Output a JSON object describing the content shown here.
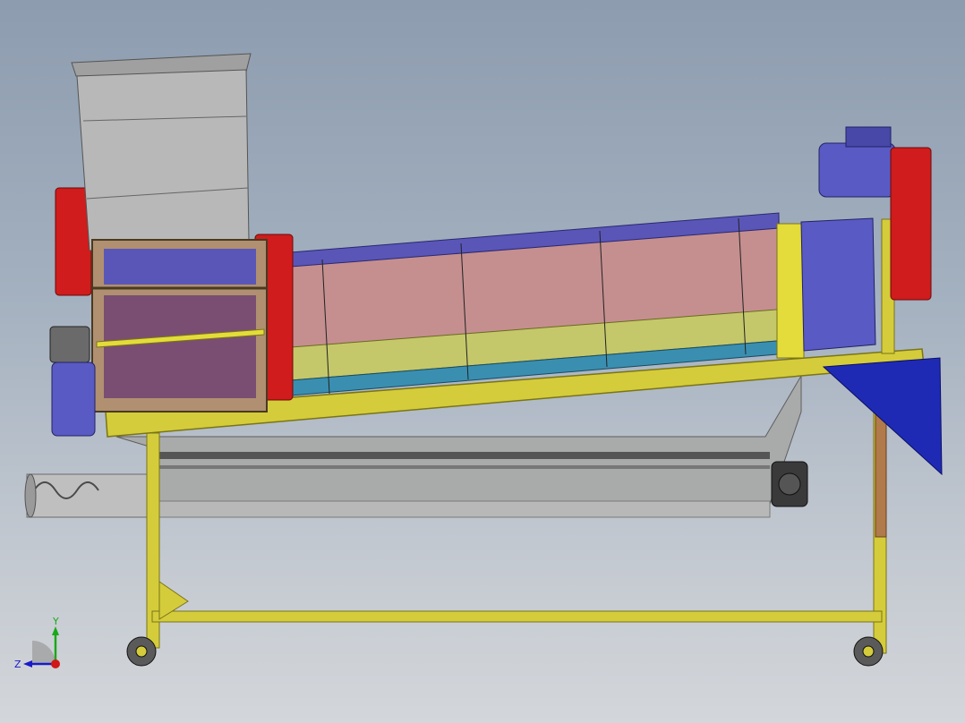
{
  "viewport": {
    "background_top": "#8d9caf",
    "background_bottom": "#d3d6da"
  },
  "triad": {
    "y_label": "Y",
    "z_label": "Z",
    "y_color": "#1aa81a",
    "z_color": "#1a1ac8",
    "origin_color": "#d01818"
  },
  "colors": {
    "frame": "#d4cc3a",
    "frame_dark": "#9c9420",
    "drum": "#c58f8f",
    "drum_top": "#5a56b8",
    "drum_rail": "#c4c86a",
    "drum_base": "#3a8fb0",
    "pulley_red": "#d01c1c",
    "motor_blue": "#5a5ac4",
    "hopper": "#b8b8b8",
    "tank": "#a8aaaa",
    "chute": "#1f2ab4",
    "leg_brown": "#b07a4a",
    "screw": "#c0c0c0",
    "caster": "#6a6a6a"
  }
}
